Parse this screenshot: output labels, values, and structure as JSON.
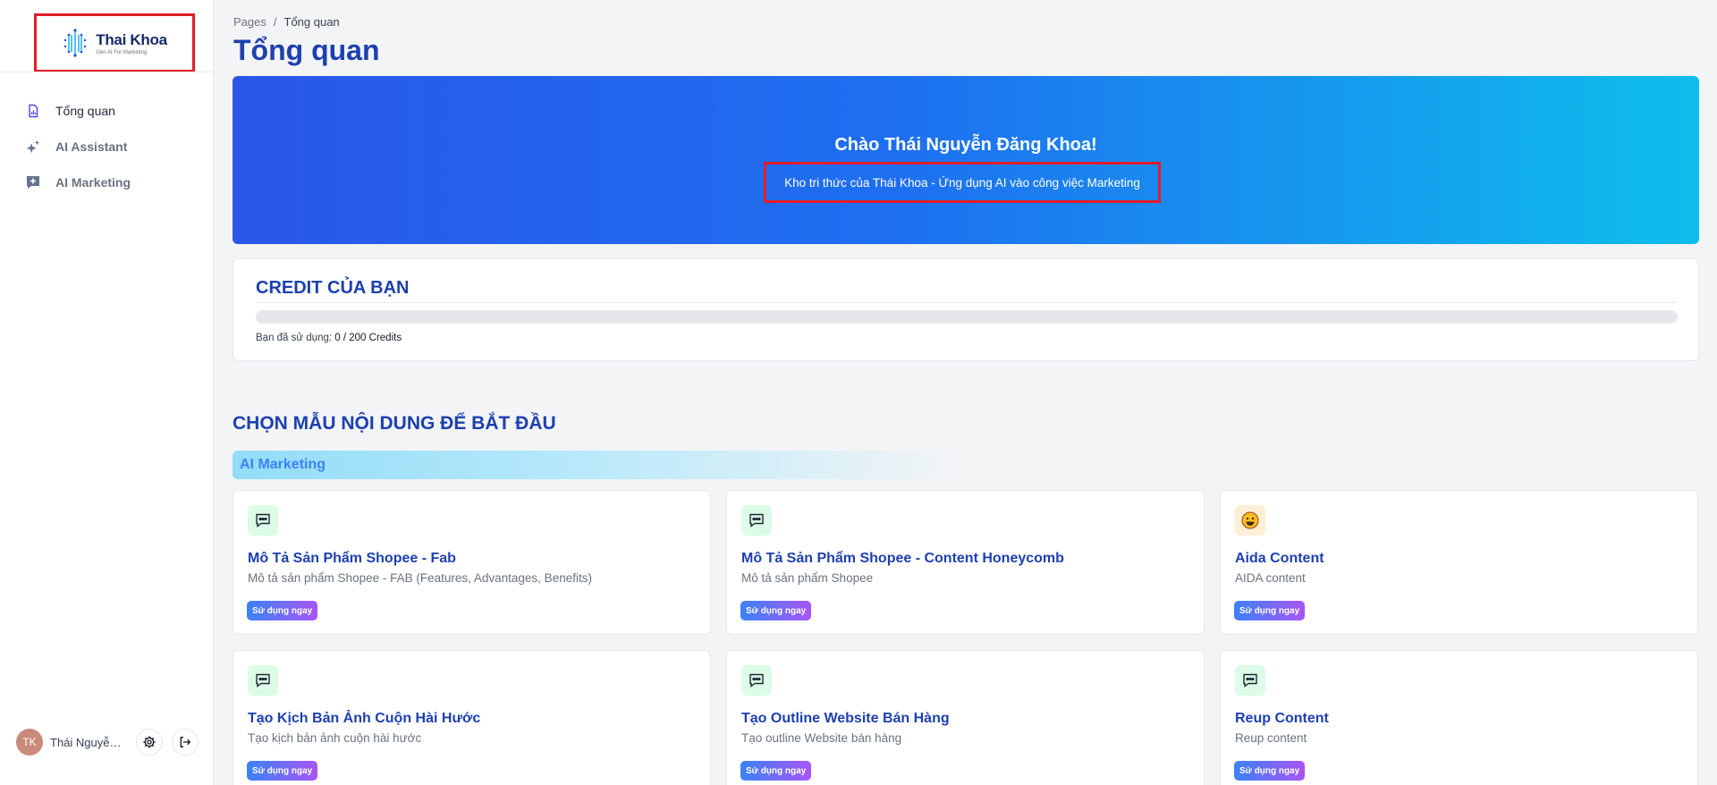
{
  "brand": {
    "name": "Thai Khoa",
    "tagline": "Gen AI For Marketing"
  },
  "sidebar": {
    "items": [
      {
        "label": "Tổng quan",
        "icon": "document-chart-icon",
        "active": true
      },
      {
        "label": "AI Assistant",
        "icon": "sparkles-icon",
        "active": false
      },
      {
        "label": "AI Marketing",
        "icon": "plus-chat-icon",
        "active": false
      }
    ]
  },
  "user": {
    "initials": "TK",
    "name": "Thái Nguyễn Đăng Khoa"
  },
  "breadcrumb": {
    "root": "Pages",
    "separator": "/",
    "current": "Tổng quan"
  },
  "page": {
    "title": "Tổng quan"
  },
  "hero": {
    "title": "Chào Thái Nguyễn Đăng Khoa!",
    "subtitle": "Kho tri thức của Thái Khoa - Ứng dụng AI vào công việc Marketing"
  },
  "credit": {
    "title": "CREDIT CỦA BẠN",
    "used_label": "Bạn đã sử dụng:",
    "used_value": "0 / 200 Credits",
    "used": 0,
    "total": 200
  },
  "templates": {
    "section_title": "CHỌN MẪU NỘI DUNG ĐỂ BẮT ĐẦU",
    "category": "AI Marketing",
    "button_label": "Sử dụng ngay",
    "cards": [
      {
        "title": "Mô Tả Sản Phẩm Shopee - Fab",
        "desc": "Mô tả sản phẩm Shopee - FAB (Features, Advantages, Benefits)",
        "icon": "chat-bubble-icon"
      },
      {
        "title": "Mô Tả Sản Phẩm Shopee - Content Honeycomb",
        "desc": "Mô tả sản phẩm Shopee",
        "icon": "chat-bubble-icon"
      },
      {
        "title": "Aida Content",
        "desc": "AIDA content",
        "icon": "smiley-icon"
      },
      {
        "title": "Tạo Kịch Bản Ảnh Cuộn Hài Hước",
        "desc": "Tạo kịch bản ảnh cuộn hài hước",
        "icon": "chat-bubble-icon"
      },
      {
        "title": "Tạo Outline Website Bán Hàng",
        "desc": "Tạo outline Website bán hàng",
        "icon": "chat-bubble-icon"
      },
      {
        "title": "Reup Content",
        "desc": "Reup content",
        "icon": "chat-bubble-icon"
      }
    ]
  },
  "colors": {
    "primary": "#1e40af",
    "hero_start": "#2a57e8",
    "hero_end": "#0ebeec",
    "highlight_box": "#e11d2a"
  }
}
